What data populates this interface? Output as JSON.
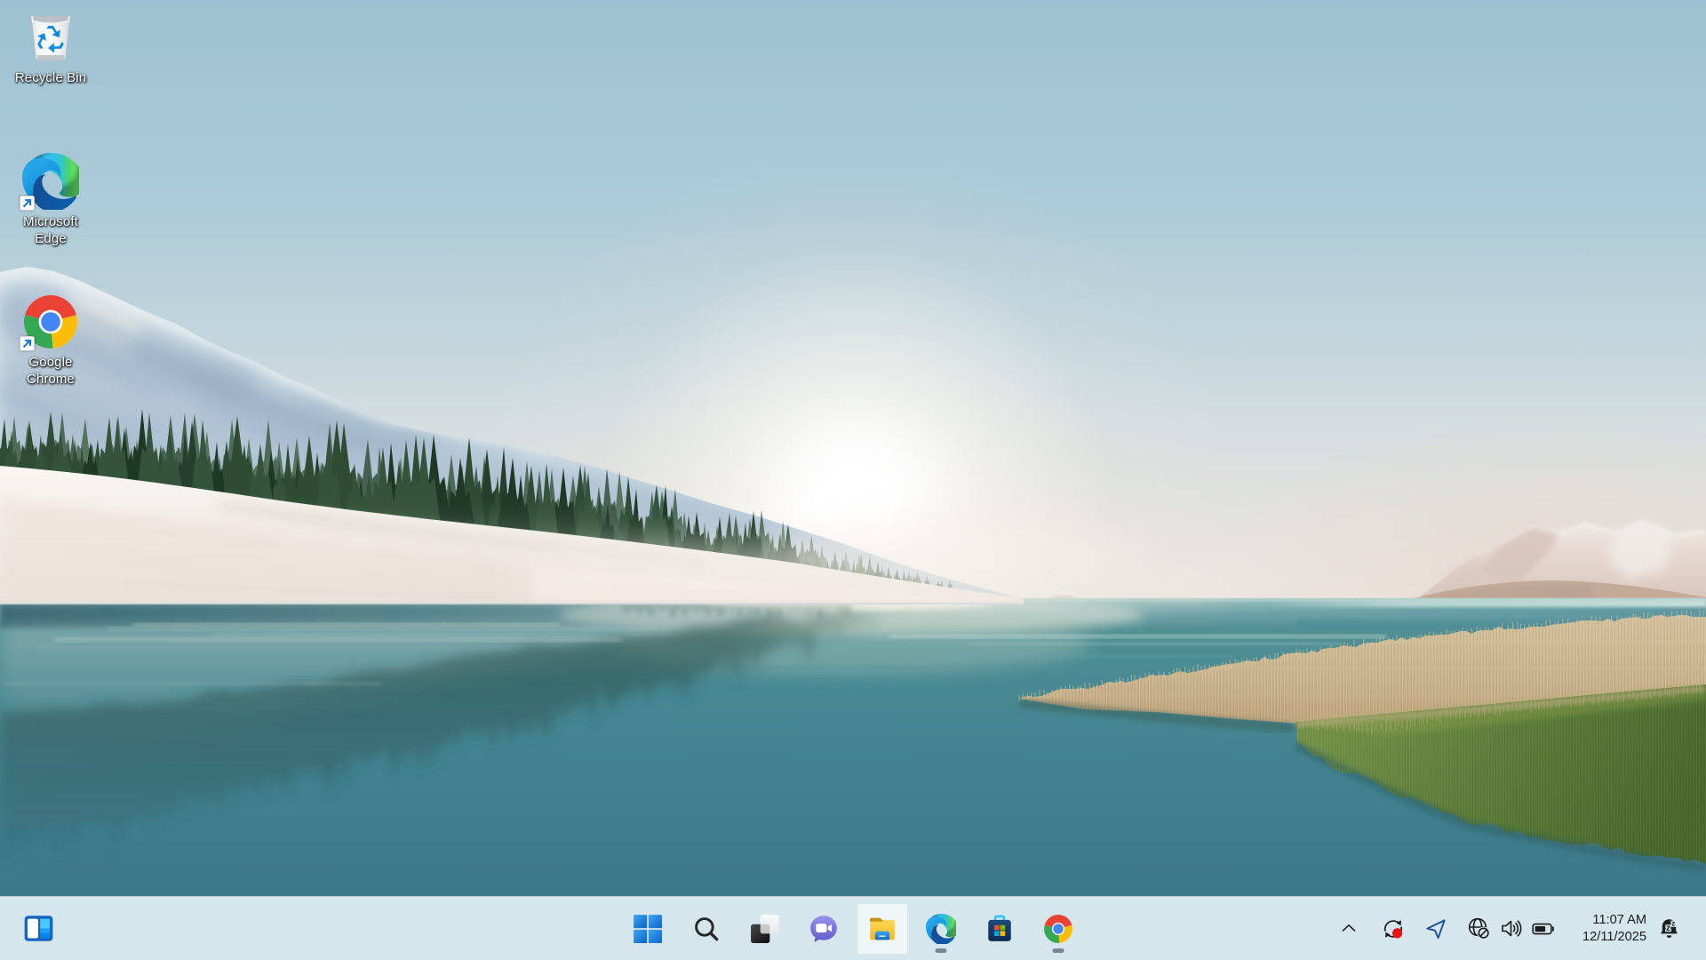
{
  "desktop": {
    "icons": [
      {
        "label": "Recycle Bin",
        "icon": "recycle-bin"
      },
      {
        "label": "Microsoft Edge",
        "icon": "edge"
      },
      {
        "label": "Google Chrome",
        "icon": "chrome"
      }
    ]
  },
  "taskbar": {
    "buttons": [
      {
        "id": "widgets",
        "label": "Widgets"
      },
      {
        "id": "start",
        "label": "Start"
      },
      {
        "id": "search",
        "label": "Search"
      },
      {
        "id": "task-view",
        "label": "Task View"
      },
      {
        "id": "chat",
        "label": "Chat"
      },
      {
        "id": "file-explorer",
        "label": "File Explorer",
        "state": "active"
      },
      {
        "id": "edge",
        "label": "Microsoft Edge",
        "state": "running"
      },
      {
        "id": "store",
        "label": "Microsoft Store"
      },
      {
        "id": "chrome",
        "label": "Google Chrome",
        "state": "running"
      }
    ],
    "tray": {
      "chevron": "Show hidden icons",
      "icons": [
        "pending-update",
        "location",
        "no-internet",
        "volume",
        "battery"
      ],
      "time": "11:07 AM",
      "date": "12/11/2025",
      "notification": "notifications-snoozed"
    }
  },
  "theme": {
    "taskbar-bg": "#d5e6ec",
    "taskbar-line": "#bcc8cd",
    "hover-bg": "rgba(255,255,255,0.62)",
    "indicator": "#788790",
    "label-color": "#ffffff",
    "clock-color": "#1b1b1b",
    "accent-red": "#ee1111",
    "tray-icon": "#1b1b1b",
    "location-blue": "#1e4f99"
  }
}
